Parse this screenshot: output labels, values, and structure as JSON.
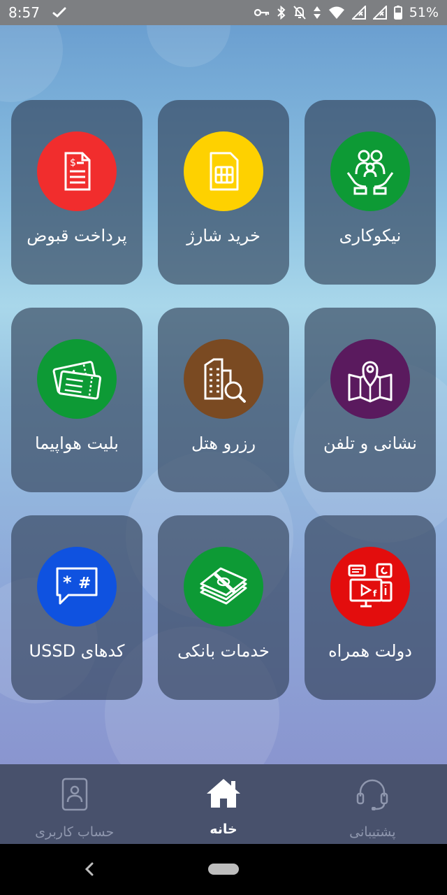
{
  "status_bar": {
    "time": "8:57",
    "battery": "51%",
    "icons": [
      "check-icon",
      "key-icon",
      "bluetooth-icon",
      "notifications-off-icon",
      "data-icon",
      "wifi-icon",
      "signal-icon",
      "signal-icon",
      "battery-icon"
    ]
  },
  "tiles": [
    {
      "label": "پرداخت قبوض",
      "icon": "bill-icon",
      "color": "#f12d2d"
    },
    {
      "label": "خرید شارژ",
      "icon": "sim-card-icon",
      "color": "#fed100"
    },
    {
      "label": "نیکوکاری",
      "icon": "charity-family-icon",
      "color": "#0d9a35"
    },
    {
      "label": "بلیت هواپیما",
      "icon": "plane-ticket-icon",
      "color": "#0d9a35"
    },
    {
      "label": "رزرو هتل",
      "icon": "hotel-search-icon",
      "color": "#7a4a22"
    },
    {
      "label": "نشانی و تلفن",
      "icon": "map-pin-icon",
      "color": "#5a1a5e"
    },
    {
      "label": "کدهای USSD",
      "icon": "ussd-chat-icon",
      "color": "#0f52e0"
    },
    {
      "label": "خدمات بانکی",
      "icon": "money-stack-icon",
      "color": "#0d9a35"
    },
    {
      "label": "دولت همراه",
      "icon": "gov-computer-icon",
      "color": "#e30d0d"
    }
  ],
  "bottom_nav": {
    "account_label": "حساب کاربری",
    "home_label": "خانه",
    "support_label": "پشتیبانی",
    "active": "home"
  }
}
